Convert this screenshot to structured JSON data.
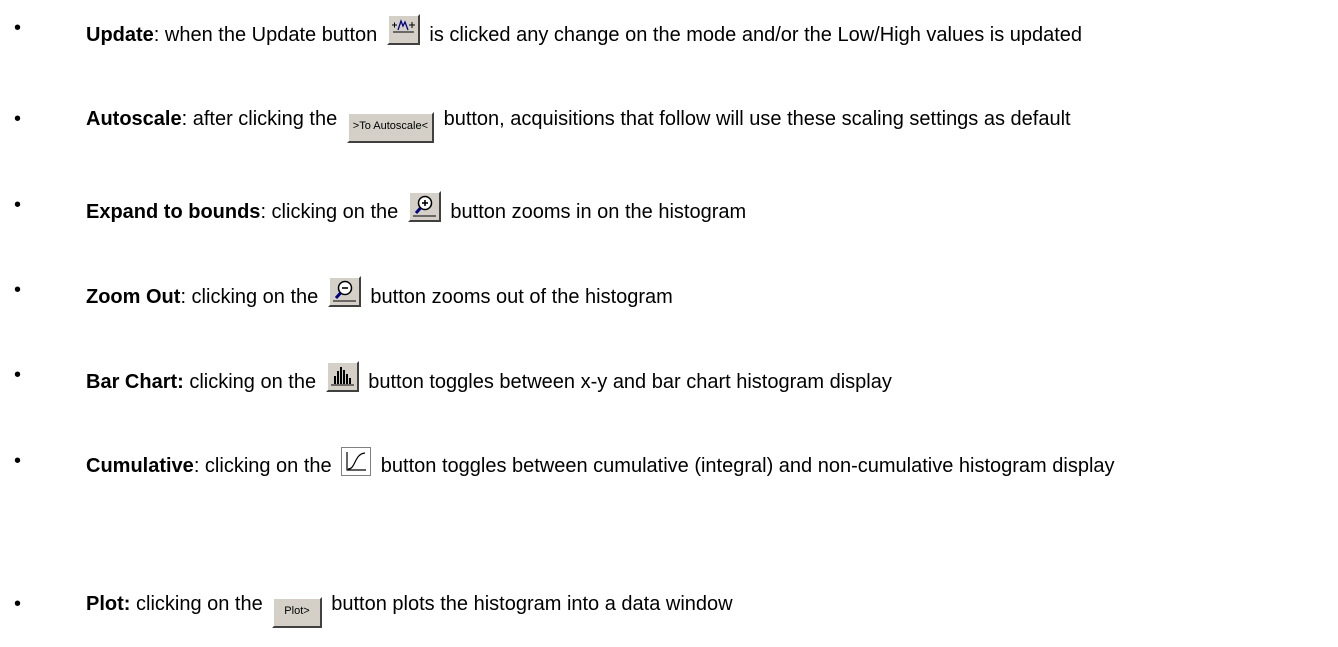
{
  "items": [
    {
      "bullet": "•",
      "label": "Update",
      "before": ": when the Update button ",
      "after": " is clicked any change on the mode and/or the Low/High values is updated",
      "icon": "update-icon"
    },
    {
      "bullet": "•",
      "label": "Autoscale",
      "before": ": after clicking the ",
      "button_text": ">To Autoscale<",
      "after": " button, acquisitions that follow will use these scaling settings as default"
    },
    {
      "bullet": "•",
      "label": "Expand to bounds",
      "before": ": clicking on the ",
      "after": " button zooms in on the histogram",
      "icon": "zoom-in-icon"
    },
    {
      "bullet": "•",
      "label": "Zoom Out",
      "before": ": clicking on the ",
      "after": " button zooms out of the histogram",
      "icon": "zoom-out-icon"
    },
    {
      "bullet": "•",
      "label": "Bar Chart:",
      "before": " clicking on the ",
      "after": " button toggles between x-y and bar chart histogram display",
      "icon": "bar-chart-icon"
    },
    {
      "bullet": "•",
      "label": "Cumulative",
      "before": ": clicking on the ",
      "after": " button toggles between cumulative (integral) and non-cumulative histogram display",
      "icon": "cumulative-icon"
    },
    {
      "bullet": "•",
      "label": "Plot:",
      "before": " clicking on the ",
      "button_text": "Plot>",
      "after": " button plots the histogram into a data window"
    }
  ]
}
